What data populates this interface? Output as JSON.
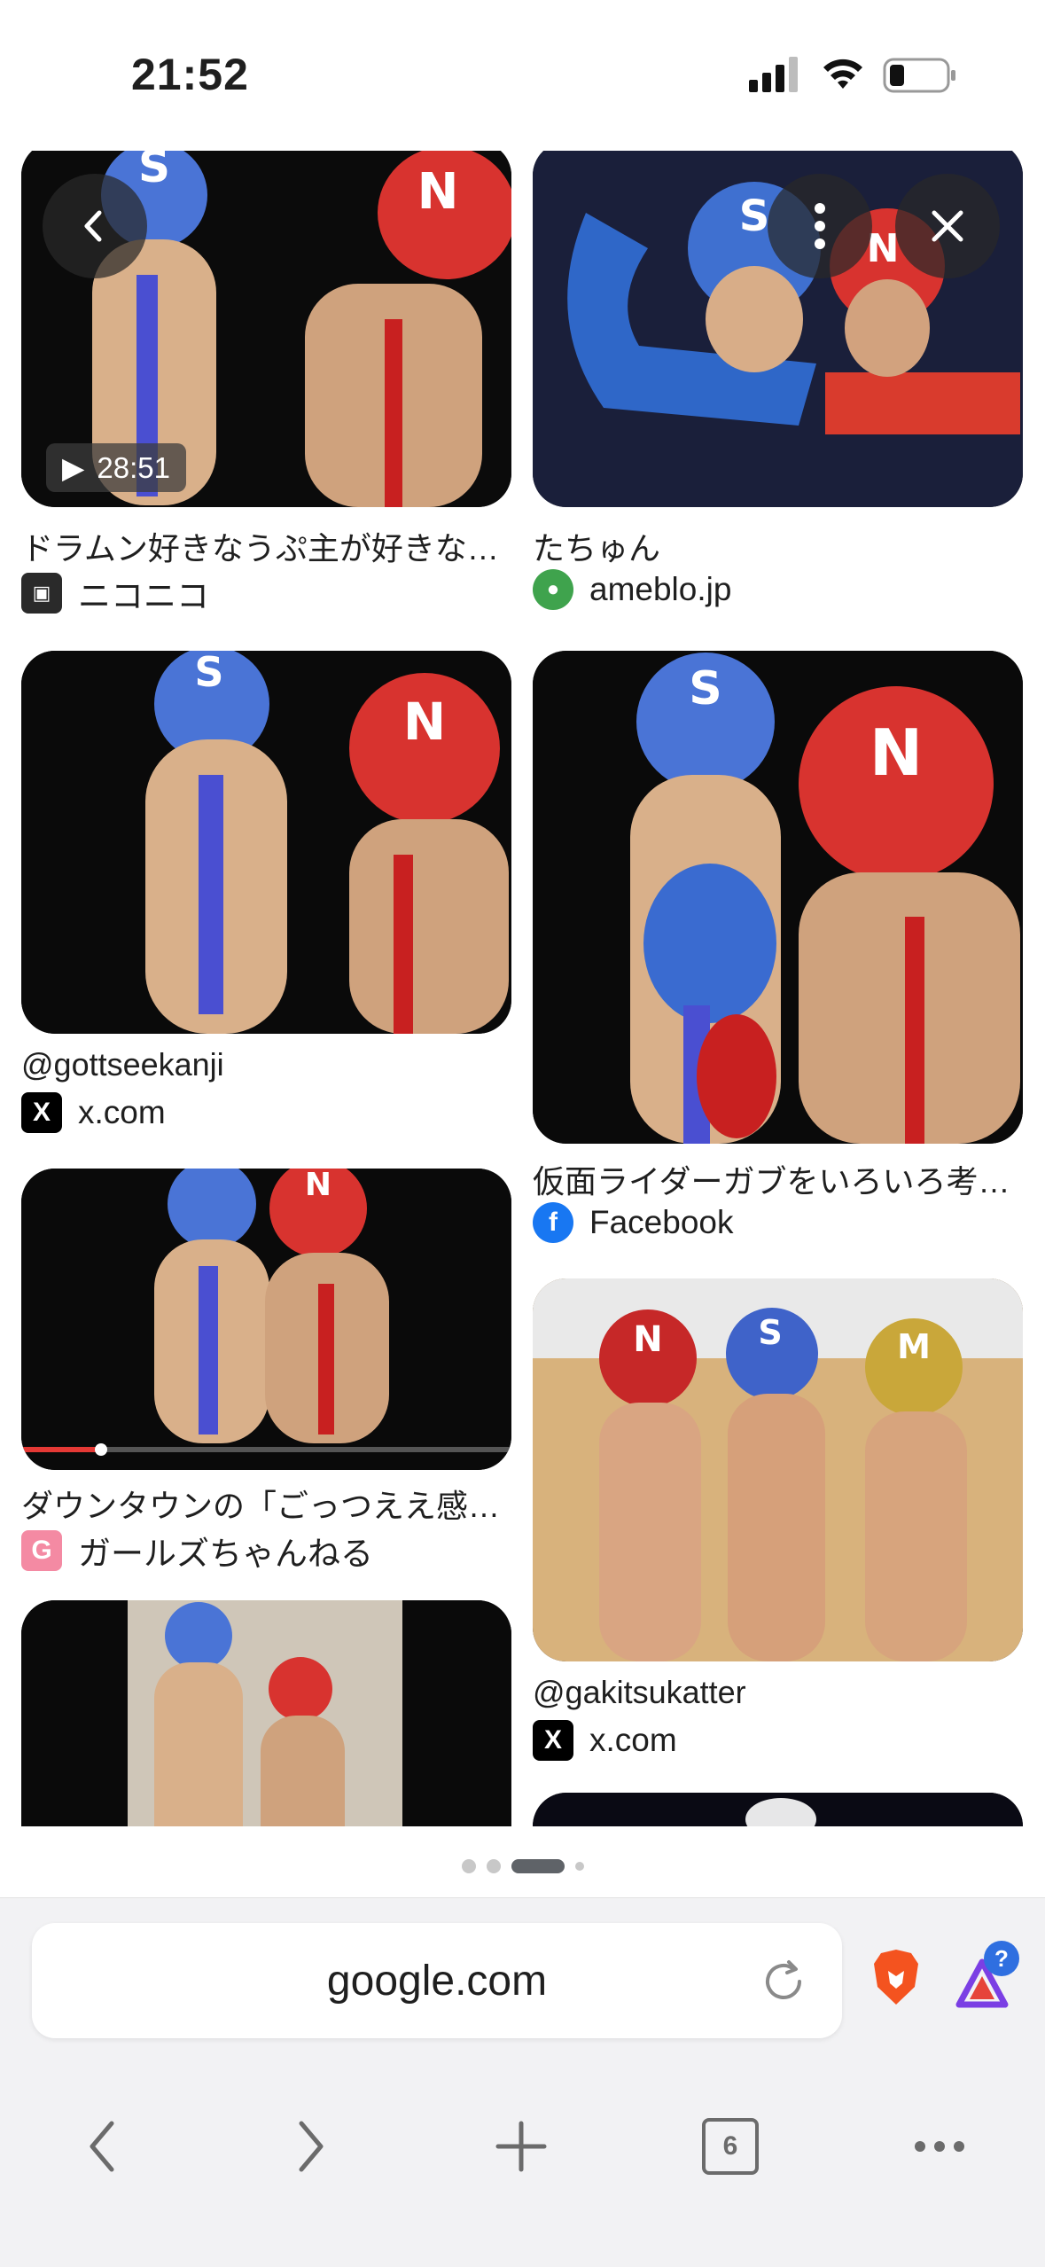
{
  "status_bar": {
    "time": "21:52"
  },
  "overlay": {
    "back_icon": "chevron-left-icon",
    "menu_icon": "more-vertical-icon",
    "close_icon": "close-icon"
  },
  "results": [
    {
      "title": "ドラムン好きなうぷ主が好きな…",
      "source": "ニコニコ",
      "favicon": "tv-icon",
      "duration": "28:51"
    },
    {
      "title": "たちゅん",
      "source": "ameblo.jp",
      "favicon": "ameba-icon"
    },
    {
      "title": "@gottseekanji",
      "source": "x.com",
      "favicon": "x-icon"
    },
    {
      "title": "仮面ライダーガブをいろいろ考…",
      "source": "Facebook",
      "favicon": "facebook-icon"
    },
    {
      "title": "ダウンタウンの「ごっつええ感…",
      "source": "ガールズちゃんねる",
      "favicon": "girls-channel-icon"
    },
    {
      "title": "@gakitsukatter",
      "source": "x.com",
      "favicon": "x-icon"
    }
  ],
  "pager": {
    "pages": 4,
    "active_index": 2
  },
  "browser": {
    "url": "google.com",
    "tab_count": "6",
    "warning_badge": "?",
    "accent": "#5f6368"
  }
}
